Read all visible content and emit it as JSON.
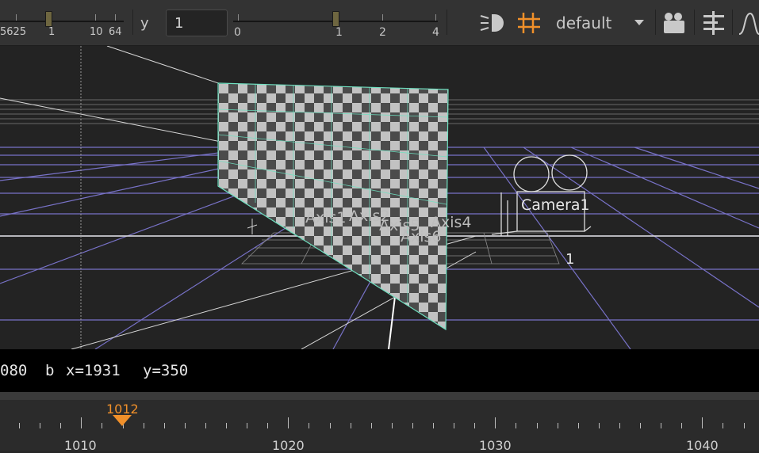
{
  "toolbar": {
    "slider1_ticks": [
      "562",
      "5",
      "1",
      "10",
      "64"
    ],
    "slider1_value": "5625",
    "y_label": "y",
    "y_value": "1",
    "slider2_ticks": [
      "0",
      "1",
      "2",
      "4"
    ],
    "view_menu": "default",
    "icons": [
      "light-icon",
      "grid-icon",
      "dropdown-arrow-icon",
      "camera-icon",
      "align-icon",
      "curve-icon"
    ]
  },
  "viewport": {
    "labels": {
      "axis1": "Axis1",
      "axis2": "Axis2",
      "axis4": "Axis4",
      "axis5": "Axis5",
      "axis6": "Axis6",
      "camera": "Camera1",
      "count": "1"
    }
  },
  "status_bar": {
    "resolution": "080",
    "channel": "b",
    "x_readout": "x=1931",
    "y_readout": "y=350"
  },
  "timeline": {
    "current_frame": "1012",
    "labels": [
      "1010",
      "1020",
      "1030",
      "1040"
    ],
    "accent": "#f0902a"
  }
}
